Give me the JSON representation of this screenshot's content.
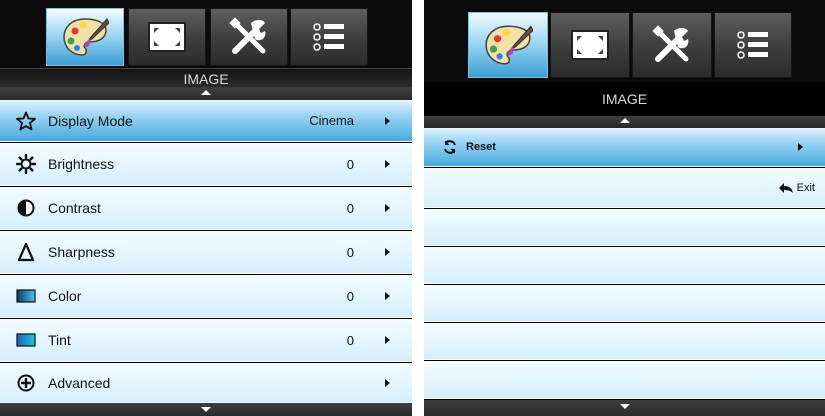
{
  "left_panel": {
    "title": "IMAGE",
    "tabs": [
      {
        "icon": "palette-icon",
        "active": true
      },
      {
        "icon": "display-frame-icon",
        "active": false
      },
      {
        "icon": "tools-icon",
        "active": false
      },
      {
        "icon": "list-icon",
        "active": false
      }
    ],
    "items": [
      {
        "label": "Display Mode",
        "value": "Cinema",
        "icon": "star-icon"
      },
      {
        "label": "Brightness",
        "value": "0",
        "icon": "brightness-icon"
      },
      {
        "label": "Contrast",
        "value": "0",
        "icon": "contrast-icon"
      },
      {
        "label": "Sharpness",
        "value": "0",
        "icon": "sharpness-icon"
      },
      {
        "label": "Color",
        "value": "0",
        "icon": "color-icon"
      },
      {
        "label": "Tint",
        "value": "0",
        "icon": "tint-icon"
      },
      {
        "label": "Advanced",
        "value": "",
        "icon": "advanced-icon"
      }
    ]
  },
  "right_panel": {
    "title": "IMAGE",
    "items": [
      {
        "label": "Reset",
        "icon": "reset-icon"
      }
    ],
    "exit_label": "Exit"
  },
  "colors": {
    "selected_row": "#46a9de",
    "row_bg": "#e2f4ff",
    "active_tab": "#9fd8f4",
    "panel_bg": "#000000"
  }
}
